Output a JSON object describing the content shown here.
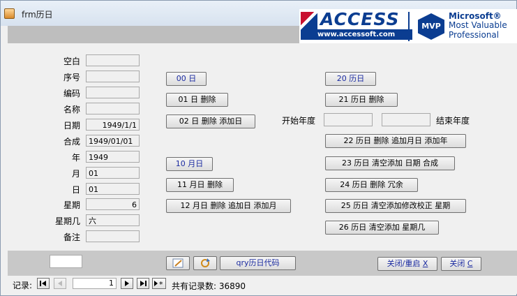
{
  "window": {
    "title": "frm历日"
  },
  "banner": {
    "access_word": "ACCESS",
    "access_url": "www.accessoft.com",
    "mvp_badge": "MVP",
    "mvp_line1": "Microsoft®",
    "mvp_line2": "Most Valuable",
    "mvp_line3": "Professional"
  },
  "fields": [
    {
      "label": "空白",
      "value": ""
    },
    {
      "label": "序号",
      "value": ""
    },
    {
      "label": "编码",
      "value": ""
    },
    {
      "label": "名称",
      "value": ""
    },
    {
      "label": "日期",
      "value": "1949/1/1"
    },
    {
      "label": "合成",
      "value": "1949/01/01"
    },
    {
      "label": "年",
      "value": "1949"
    },
    {
      "label": "月",
      "value": "01"
    },
    {
      "label": "日",
      "value": "01"
    },
    {
      "label": "星期",
      "value": "6"
    },
    {
      "label": "星期几",
      "value": "六"
    },
    {
      "label": "备注",
      "value": ""
    }
  ],
  "buttons": {
    "b00": "00 日",
    "b01": "01 日 删除",
    "b02": "02 日 删除 添加日",
    "b10": "10 月日",
    "b11": "11 月日 删除",
    "b12": "12 月日 删除 追加日 添加月",
    "b20": "20 历日",
    "b21": "21 历日 删除",
    "b22": "22 历日 删除 追加月日 添加年",
    "b23": "23 历日 清空添加 日期 合成",
    "b24": "24 历日 删除 冗余",
    "b25": "25 历日 清空添加修改校正 星期",
    "b26": "26 历日 清空添加 星期几"
  },
  "year_range": {
    "start_label": "开始年度",
    "start_value": "",
    "end_value": "",
    "end_label": "结束年度"
  },
  "footer": {
    "small_box": "",
    "qry_button": "qry历日代码",
    "close_reopen_text": "关闭/重启 ",
    "close_reopen_key": "X",
    "close_text": "关闭 ",
    "close_key": "C"
  },
  "navigation": {
    "record_label": "记录:",
    "current_record": "1",
    "total_label": "共有记录数: 36890"
  }
}
